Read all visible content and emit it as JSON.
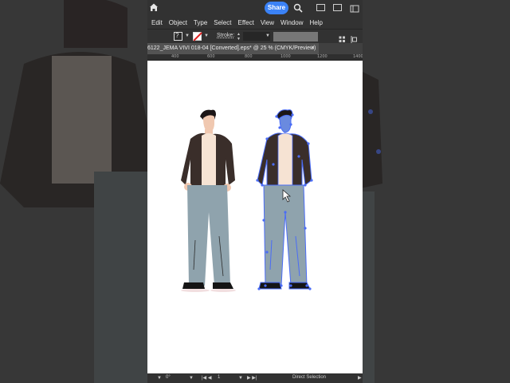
{
  "menubar": {
    "items": [
      "Edit",
      "Object",
      "Type",
      "Select",
      "Effect",
      "View",
      "Window",
      "Help"
    ]
  },
  "topbar": {
    "share_label": "Share"
  },
  "control_bar": {
    "fill_symbol": "?",
    "stroke_label": "Stroke:"
  },
  "document_tab": {
    "title": "6122_JEMA VIVI 018-04 [Converted].eps* @ 25 % (CMYK/Preview)",
    "close_symbol": "×"
  },
  "ruler": {
    "ticks": [
      "400",
      "600",
      "800",
      "1000",
      "1200",
      "1400"
    ]
  },
  "status_bar": {
    "rotation": "0°",
    "artboard_number": "1",
    "tool_name": "Direct Selection"
  },
  "colors": {
    "accent": "#3b82f6",
    "selection_outline": "#4a6cf7",
    "jacket": "#3a2e2a",
    "shirt": "#f6e3d3",
    "pants": "#8fa3ad",
    "skin": "#f0c8b0"
  },
  "icons": [
    "home-icon",
    "search-icon",
    "workspace-icon",
    "panel-icon",
    "fill-swatch-icon",
    "stroke-swatch-icon",
    "align-icon",
    "close-icon"
  ]
}
